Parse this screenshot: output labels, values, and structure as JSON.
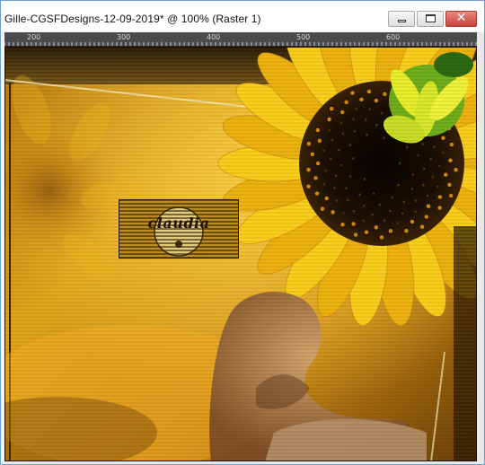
{
  "window": {
    "title": "Gille-CGSFDesigns-12-09-2019* @ 100% (Raster 1)",
    "controls": {
      "minimize_label": "",
      "maximize_label": "",
      "close_glyph": "✕"
    },
    "accent_border": "#6f9fcf",
    "close_color": "#c9413a"
  },
  "ruler": {
    "labels": [
      "200",
      "300",
      "400",
      "500",
      "600"
    ]
  },
  "canvas": {
    "watermark_text": "claudia",
    "dominant_colors": [
      "#e0a416",
      "#f3c21c",
      "#8a5a10",
      "#2a1a05"
    ],
    "icons": [
      "sunflower-image",
      "logo-watermark"
    ]
  }
}
